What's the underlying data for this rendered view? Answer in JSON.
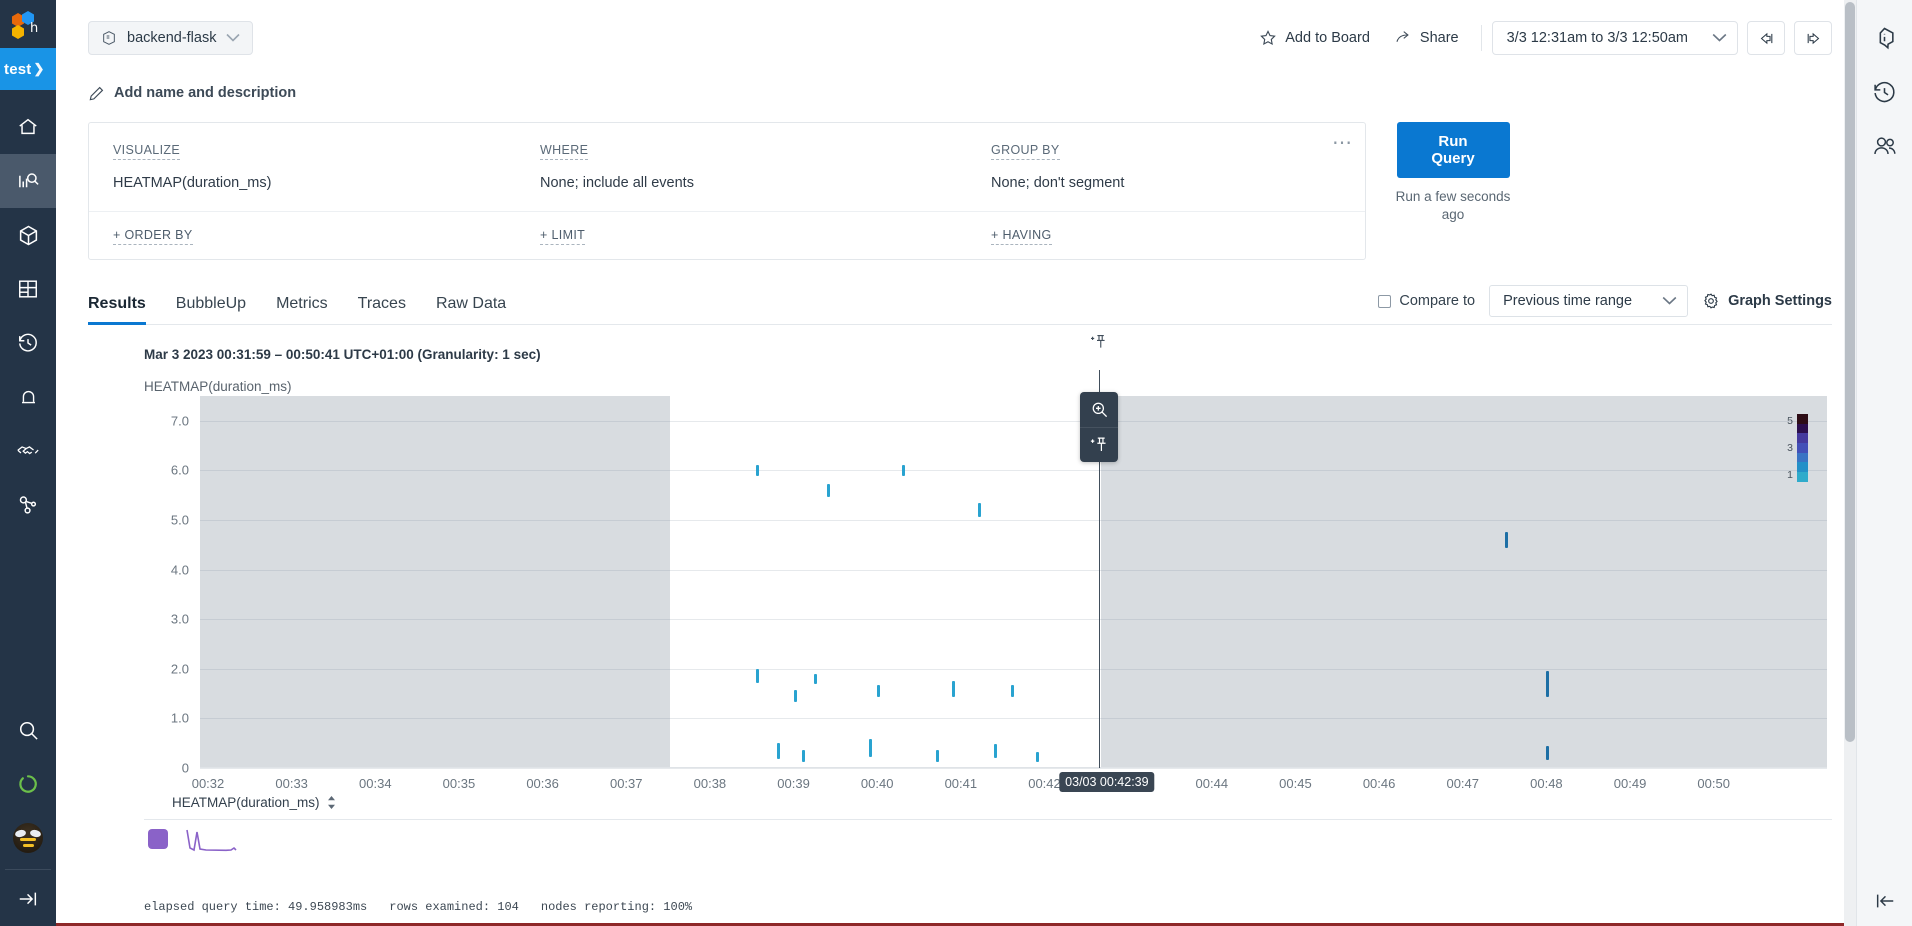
{
  "leftnav": {
    "logo_alt": "honeycomb-logo",
    "environment": "test",
    "items": [
      {
        "name": "home",
        "icon": "home-icon",
        "active": false
      },
      {
        "name": "query",
        "icon": "query-bar-chart-icon",
        "active": true
      },
      {
        "name": "datasets",
        "icon": "cube-icon",
        "active": false
      },
      {
        "name": "boards",
        "icon": "boards-grid-icon",
        "active": false
      },
      {
        "name": "history",
        "icon": "history-clock-icon",
        "active": false
      },
      {
        "name": "triggers",
        "icon": "bell-icon",
        "active": false
      },
      {
        "name": "slos",
        "icon": "handshake-icon",
        "active": false
      },
      {
        "name": "service-map",
        "icon": "nodes-graph-icon",
        "active": false
      }
    ],
    "bottom_items": [
      {
        "name": "search",
        "icon": "search-icon"
      },
      {
        "name": "status",
        "icon": "loading-ring-icon"
      },
      {
        "name": "account",
        "icon": "bee-avatar-icon"
      },
      {
        "name": "expand-nav",
        "icon": "expand-right-icon"
      }
    ]
  },
  "topbar": {
    "dataset": "backend-flask",
    "dataset_icon": "dataset-box-icon",
    "add_to_board": "Add to Board",
    "add_to_board_icon": "star-icon",
    "share": "Share",
    "share_icon": "share-arrow-icon",
    "time_range": "3/3 12:31am to 3/3 12:50am",
    "prev_icon": "arrow-left-icon",
    "next_icon": "arrow-right-icon"
  },
  "namedesc": {
    "label": "Add name and description",
    "icon": "pencil-icon"
  },
  "query_builder": {
    "more_icon": "ellipsis-icon",
    "clauses": [
      {
        "label": "VISUALIZE",
        "value": "HEATMAP(duration_ms)"
      },
      {
        "label": "WHERE",
        "value": "None; include all events"
      },
      {
        "label": "GROUP BY",
        "value": "None; don't segment"
      }
    ],
    "add_clauses": [
      "+ ORDER BY",
      "+ LIMIT",
      "+ HAVING"
    ],
    "run_button": "Run Query",
    "run_status": "Run a few\nseconds ago"
  },
  "tabs": {
    "items": [
      {
        "label": "Results",
        "active": true
      },
      {
        "label": "BubbleUp",
        "active": false
      },
      {
        "label": "Metrics",
        "active": false
      },
      {
        "label": "Traces",
        "active": false
      },
      {
        "label": "Raw Data",
        "active": false
      }
    ],
    "compare_label": "Compare to",
    "compare_checked": false,
    "compare_value": "Previous time range",
    "graph_settings": "Graph Settings",
    "graph_settings_icon": "gear-icon"
  },
  "chart_data": {
    "type": "heatmap",
    "title": "HEATMAP(duration_ms)",
    "caption": "Mar 3 2023 00:31:59 – 00:50:41 UTC+01:00 (Granularity: 1 sec)",
    "xlabel": "",
    "ylabel": "",
    "ylim": [
      0,
      7.5
    ],
    "yticks": [
      "7.0",
      "6.0",
      "5.0",
      "4.0",
      "3.0",
      "2.0",
      "1.0",
      "0"
    ],
    "ytick_values": [
      7.0,
      6.0,
      5.0,
      4.0,
      3.0,
      2.0,
      1.0,
      0
    ],
    "xticks": [
      "00:32",
      "00:33",
      "00:34",
      "00:35",
      "00:36",
      "00:37",
      "00:38",
      "00:39",
      "00:40",
      "00:41",
      "00:42",
      "00:43",
      "00:44",
      "00:45",
      "00:46",
      "00:47",
      "00:48",
      "00:49",
      "00:50"
    ],
    "grid": true,
    "crosshair_label": "03/03 00:42:39",
    "crosshair_time": "00:42:39",
    "shaded_regions": [
      {
        "from": "00:31:59",
        "to": "00:37:30",
        "note": "no-data-left"
      },
      {
        "from": "00:42:40",
        "to": "00:50:41",
        "note": "no-data-right"
      }
    ],
    "color_scale": {
      "max_label": "5",
      "mid_label": "3",
      "min_label": "1",
      "colors": [
        "#2e0d16",
        "#2c0f4e",
        "#453a9e",
        "#4350b8",
        "#3a74c4",
        "#2490c8",
        "#2fabcb"
      ]
    },
    "points": [
      {
        "x": "00:38:55",
        "y": 6.0,
        "h": 11
      },
      {
        "x": "00:39:40",
        "y": 5.6,
        "h": 13
      },
      {
        "x": "00:40:30",
        "y": 6.0,
        "h": 11
      },
      {
        "x": "00:41:20",
        "y": 5.2,
        "h": 14
      },
      {
        "x": "00:47:50",
        "y": 4.6,
        "h": 16
      },
      {
        "x": "00:38:55",
        "y": 1.85,
        "h": 14
      },
      {
        "x": "00:39:25",
        "y": 1.8,
        "h": 10
      },
      {
        "x": "00:39:00",
        "y": 1.45,
        "h": 12
      },
      {
        "x": "00:40:00",
        "y": 1.55,
        "h": 12
      },
      {
        "x": "00:40:90",
        "y": 1.6,
        "h": 16
      },
      {
        "x": "00:41:60",
        "y": 1.55,
        "h": 12
      },
      {
        "x": "00:48:00",
        "y": 1.7,
        "h": 26
      },
      {
        "x": "00:38:80",
        "y": 0.35,
        "h": 16
      },
      {
        "x": "00:39:10",
        "y": 0.25,
        "h": 12
      },
      {
        "x": "00:39:90",
        "y": 0.4,
        "h": 18
      },
      {
        "x": "00:40:70",
        "y": 0.25,
        "h": 12
      },
      {
        "x": "00:41:40",
        "y": 0.35,
        "h": 14
      },
      {
        "x": "00:41:90",
        "y": 0.22,
        "h": 10
      },
      {
        "x": "00:48:00",
        "y": 0.3,
        "h": 14
      }
    ],
    "crosshair_actions": [
      {
        "name": "zoom-in",
        "icon": "magnify-plus-icon"
      },
      {
        "name": "pin-marker",
        "icon": "pin-plus-icon"
      }
    ]
  },
  "series_footer": {
    "header": "HEATMAP(duration_ms)",
    "sort_icon": "sort-arrows-icon",
    "swatch_color": "#8a62c8"
  },
  "statusbar": {
    "elapsed": "elapsed query time: 49.958983ms",
    "rows": "rows examined: 104",
    "nodes": "nodes reporting: 100%"
  },
  "rightrail": {
    "items": [
      {
        "name": "info",
        "icon": "info-hex-icon"
      },
      {
        "name": "history",
        "icon": "history-clock-icon"
      },
      {
        "name": "collaborators",
        "icon": "people-icon"
      }
    ],
    "collapse_icon": "collapse-left-icon"
  }
}
